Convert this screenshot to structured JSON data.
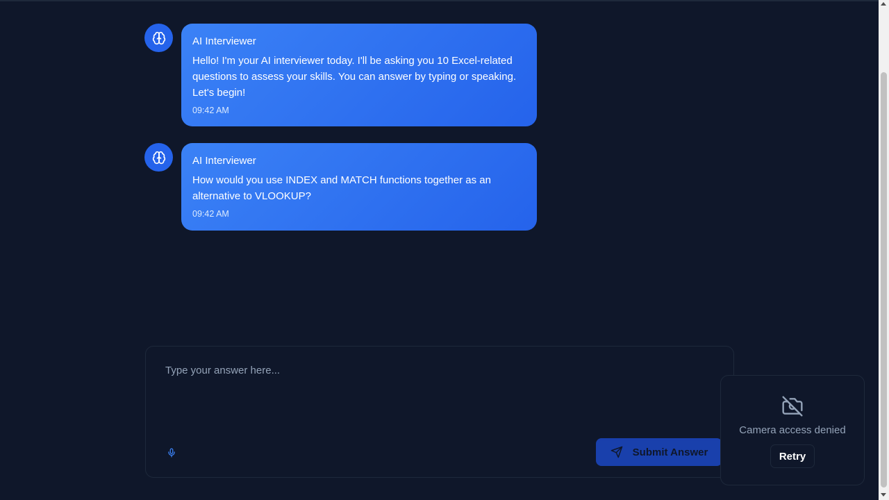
{
  "messages": [
    {
      "sender": "AI Interviewer",
      "text": "Hello! I'm your AI interviewer today. I'll be asking you 10 Excel-related questions to assess your skills. You can answer by typing or speaking. Let's begin!",
      "time": "09:42 AM"
    },
    {
      "sender": "AI Interviewer",
      "text": "How would you use INDEX and MATCH functions together as an alternative to VLOOKUP?",
      "time": "09:42 AM"
    }
  ],
  "answer": {
    "placeholder": "Type your answer here...",
    "value": "",
    "submit_label": "Submit Answer"
  },
  "camera": {
    "status_text": "Camera access denied",
    "retry_label": "Retry"
  },
  "icons": {
    "avatar": "brain-icon",
    "mic": "mic-icon",
    "submit": "send-icon",
    "camera": "camera-off-icon"
  },
  "colors": {
    "background": "#0f172a",
    "accent": "#2563eb",
    "bubble_start": "#3b82f6",
    "muted_text": "#94a3b8"
  }
}
